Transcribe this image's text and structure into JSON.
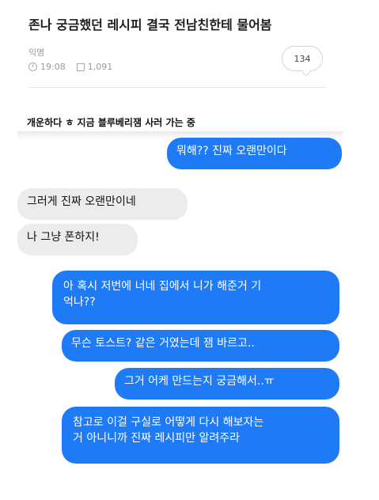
{
  "post": {
    "title": "존나 궁금했던 레시피 결국 전남친한테 물어봄",
    "author": "익명",
    "time": "19:08",
    "views": "1,091",
    "comment_count": "134"
  },
  "chat": {
    "header": "개운하다 ㅎ 지금 블루베리잼 사러 가는 중",
    "messages": [
      {
        "side": "sent",
        "lines": [
          "뭐해?? 진짜 오랜만이다"
        ]
      },
      {
        "side": "received",
        "lines": [
          "그러게 진짜 오랜만이네"
        ]
      },
      {
        "side": "received",
        "lines": [
          "나 그냥 폰하지!"
        ]
      },
      {
        "side": "sent",
        "lines": [
          "아 혹시 저번에 너네 집에서 니가 해준거 기",
          "억나??"
        ]
      },
      {
        "side": "sent",
        "lines": [
          "무슨 토스트? 같은 거였는데 잼 바르고.."
        ]
      },
      {
        "side": "sent",
        "lines": [
          "그거 어케 만드는지 궁금해서..ㅠ"
        ]
      },
      {
        "side": "sent",
        "lines": [
          "참고로 이걸 구실로 어떻게 다시 해보자는",
          "거 아니니까 진짜 레시피만 알려주라"
        ]
      }
    ]
  },
  "colors": {
    "sent_bubble": "#1e7bf5",
    "received_bubble": "#ececec"
  }
}
